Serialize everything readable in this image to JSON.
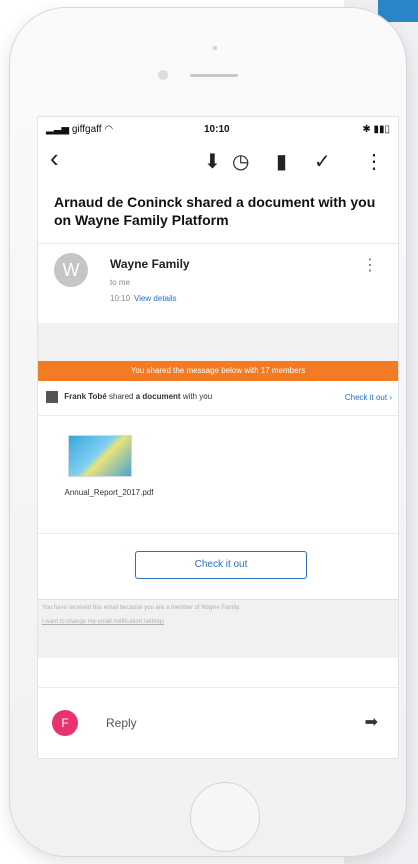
{
  "status_bar": {
    "carrier": "giffgaff",
    "time": "10:10",
    "signal_icon": "signal-icon",
    "wifi_icon": "wifi-icon",
    "battery_icon": "battery-icon"
  },
  "toolbar": {
    "back_glyph": "‹",
    "pin_glyph": "⬇",
    "snooze_glyph": "◷",
    "delete_glyph": "▮",
    "done_glyph": "✓",
    "more_glyph": "⋮"
  },
  "email": {
    "subject": "Arnaud de Coninck shared a document with you on Wayne Family Platform",
    "sender_initial": "W",
    "sender_name": "Wayne Family",
    "to": "to me",
    "time": "10:10",
    "view_details": "View details",
    "menu_glyph": "⋮"
  },
  "banner": {
    "text": "You shared the message below with 17 members"
  },
  "share": {
    "sharer": "Frank Tobé",
    "verb": "shared",
    "object": "a document",
    "suffix": "with you",
    "check_link": "Check it out",
    "link_arrow": "›",
    "file_name": "Annual_Report_2017.pdf",
    "cta": "Check it out"
  },
  "footer": {
    "reason": "You have received this email because you are a member of Wayne Family.",
    "settings_link": "I want to change my email notification settings"
  },
  "reply": {
    "initial": "F",
    "label": "Reply",
    "send_glyph": "➡"
  },
  "colors": {
    "orange": "#f27b23",
    "blue": "#2a6fc2",
    "reply_avatar": "#e8336d"
  }
}
